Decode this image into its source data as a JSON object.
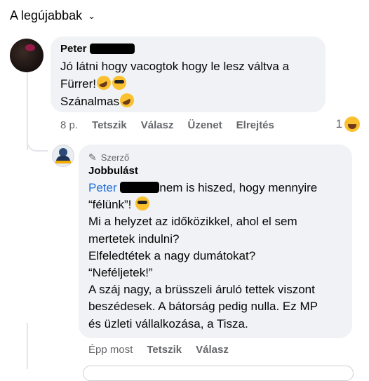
{
  "header": {
    "sort_label": "A legújabbak"
  },
  "comment": {
    "author_first": "Peter",
    "line1": "Jó látni hogy vacogtok hogy le lesz váltva a",
    "line2": "Fürrer!",
    "line3": "Szánalmas",
    "time": "8 p.",
    "actions": [
      "Tetszik",
      "Válasz",
      "Üzenet",
      "Elrejtés"
    ],
    "reaction_count": "1"
  },
  "reply": {
    "badge": "Szerző",
    "author": "Jobbulást",
    "mention_first": "Peter",
    "text_part1": "nem is hiszed, hogy mennyire",
    "text_part2": "“félünk”!",
    "lines": [
      "Mi a helyzet az időközikkel, ahol el sem",
      "mertetek indulni?",
      "Elfeledtétek a nagy dumátokat?",
      "“Neféljetek!”",
      "A száj nagy, a brüsszeli áruló tettek viszont",
      "beszédesek. A bátorság pedig nulla. Ez MP",
      "és üzleti vállalkozása, a Tisza."
    ],
    "time": "Épp most",
    "actions": [
      "Tetszik",
      "Válasz"
    ]
  },
  "colors": {
    "accent": "#216fdb",
    "bubble": "#f0f2f5",
    "secondary_text": "#65676b"
  },
  "icons": [
    "chevron-down-icon",
    "pencil-icon",
    "laughing-emoji-icon",
    "sunglasses-emoji-icon",
    "rofl-emoji-icon"
  ]
}
